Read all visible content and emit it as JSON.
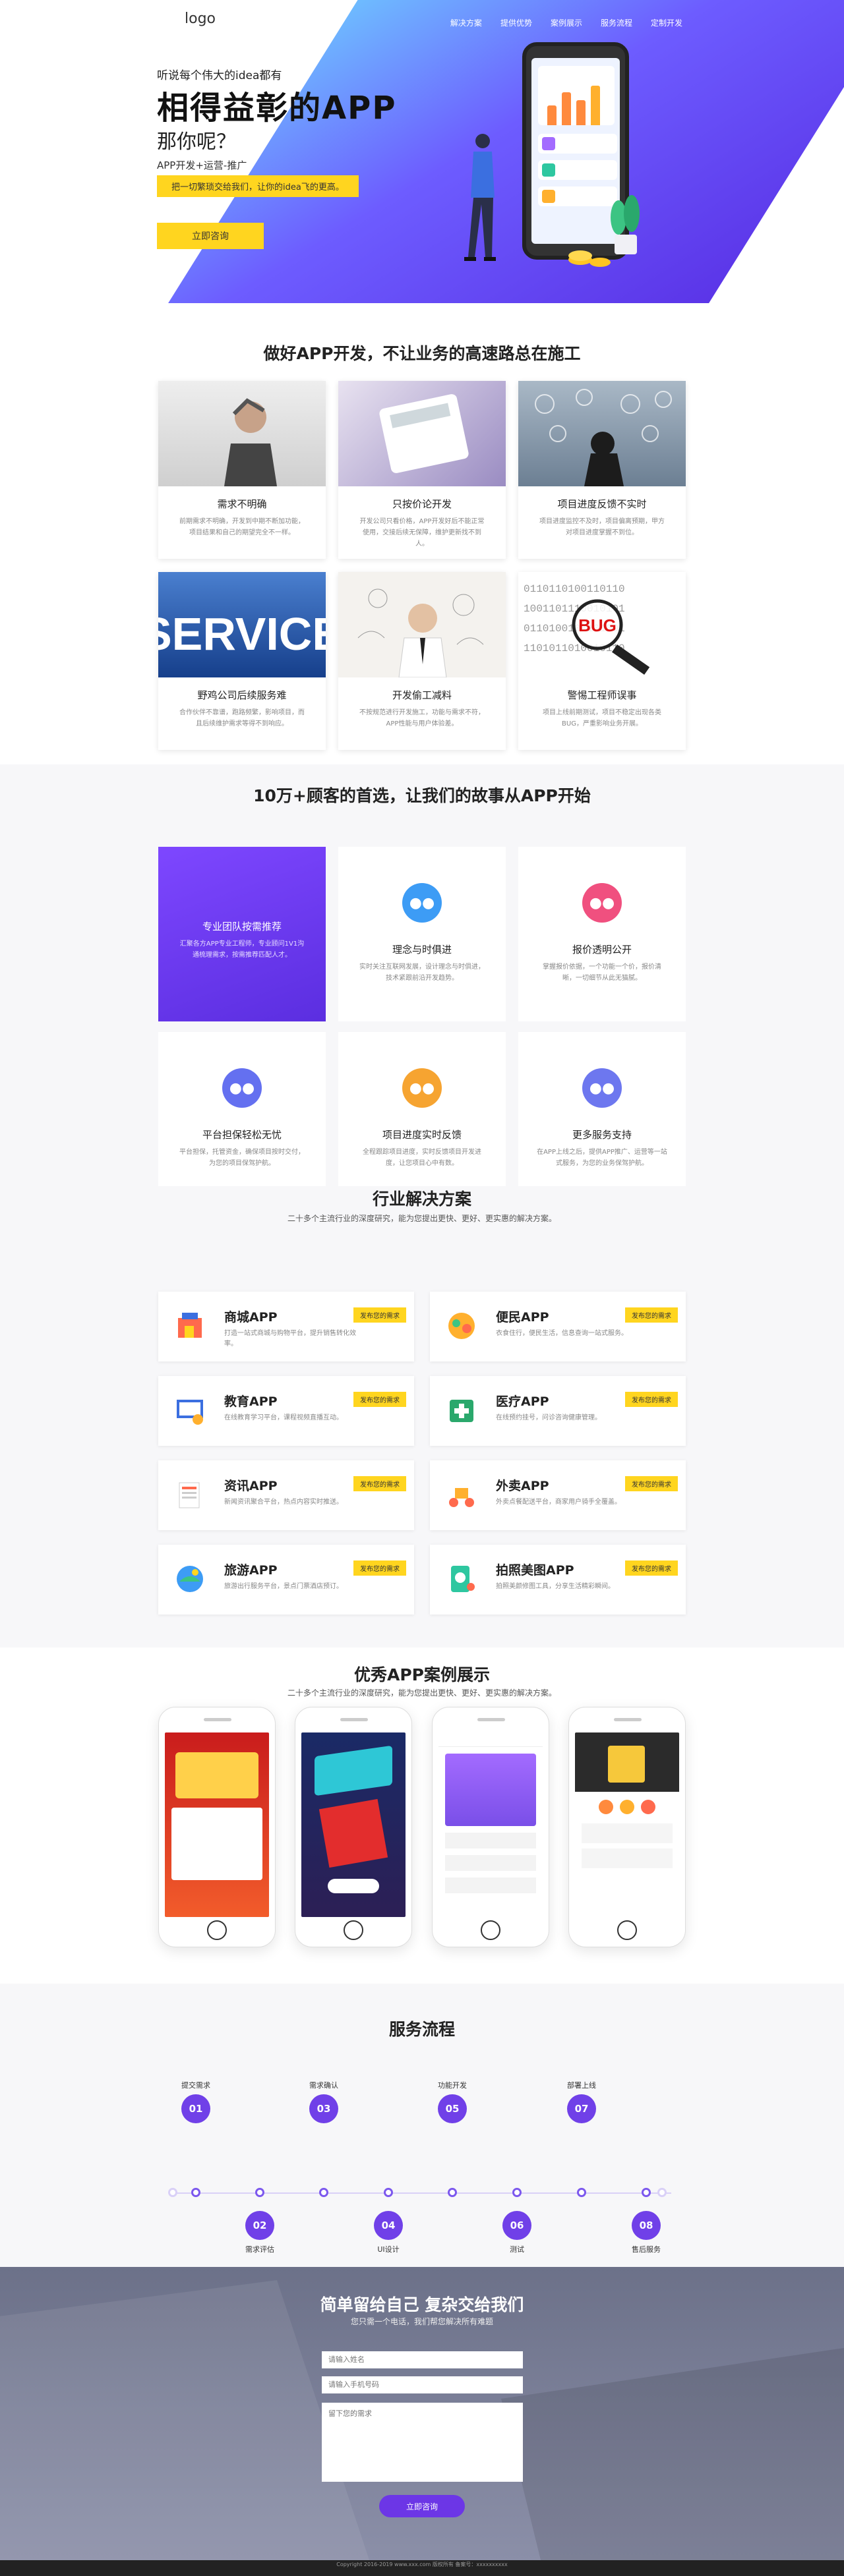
{
  "header": {
    "logo": "logo",
    "nav": [
      "解决方案",
      "提供优势",
      "案例展示",
      "服务流程",
      "定制开发"
    ]
  },
  "hero": {
    "subtitle": "听说每个伟大的idea都有",
    "title": "相得益彰的APP",
    "question": "那你呢？",
    "line": "APP开发+运营-推广",
    "tag": "把一切繁琐交给我们，让你的idea飞的更高。",
    "button": "立即咨询"
  },
  "section2": {
    "title": "做好APP开发，不让业务的高速路总在施工",
    "cards": [
      {
        "title": "需求不明确",
        "desc": "前期需求不明确，开发到中期不断加功能，项目结果和自己的期望完全不一样。"
      },
      {
        "title": "只按价论开发",
        "desc": "开发公司只看价格，APP开发好后不能正常使用，交接后续无保障，维护更新找不到人。"
      },
      {
        "title": "项目进度反馈不实时",
        "desc": "项目进度监控不及时，项目偏离预期，甲方对项目进度掌握不到位。"
      },
      {
        "title": "野鸡公司后续服务难",
        "desc": "合作伙伴不靠谱，跑路频繁，影响项目，而且后续维护需求等得不到响应。"
      },
      {
        "title": "开发偷工减料",
        "desc": "不按规范进行开发施工，功能与需求不符，APP性能与用户体验差。"
      },
      {
        "title": "警惕工程师误事",
        "desc": "项目上线前期测试，项目不稳定出现各类BUG，严重影响业务开展。"
      }
    ]
  },
  "section3": {
    "title": "10万+顾客的首选，让我们的故事从APP开始",
    "featured": {
      "title": "专业团队按需推荐",
      "desc": "汇聚各方APP专业工程师，专业顾问1V1沟通梳理需求，按需推荐匹配人才。"
    },
    "cards": [
      {
        "title": "理念与时俱进",
        "desc": "实时关注互联网发展，设计理念与时俱进，技术紧跟前沿开发趋势。",
        "color": "#3d9cf5"
      },
      {
        "title": "报价透明公开",
        "desc": "掌握报价依据，一个功能一个价，报价清晰，一切细节从此无猫腻。",
        "color": "#f0507f"
      },
      {
        "title": "平台担保轻松无忧",
        "desc": "平台担保，托管资金，确保项目按时交付，为您的项目保驾护航。",
        "color": "#6470f0"
      },
      {
        "title": "项目进度实时反馈",
        "desc": "全程跟踪项目进度，实时反馈项目开发进度，让您项目心中有数。",
        "color": "#f6a431"
      },
      {
        "title": "更多服务支持",
        "desc": "在APP上线之后，提供APP推广、运营等一站式服务，为您的业务保驾护航。",
        "color": "#6d77ef"
      }
    ]
  },
  "section4": {
    "title": "行业解决方案",
    "subtitle": "二十多个主流行业的深度研究，能为您提出更快、更好、更实惠的解决方案。",
    "tag": "发布您的需求",
    "items": [
      {
        "title": "商城APP",
        "desc": "打造一站式商城与购物平台，提升销售转化效率。"
      },
      {
        "title": "便民APP",
        "desc": "衣食住行，便民生活，信息查询一站式服务。"
      },
      {
        "title": "教育APP",
        "desc": "在线教育学习平台，课程视频直播互动。"
      },
      {
        "title": "医疗APP",
        "desc": "在线预约挂号，问诊咨询健康管理。"
      },
      {
        "title": "资讯APP",
        "desc": "新闻资讯聚合平台，热点内容实时推送。"
      },
      {
        "title": "外卖APP",
        "desc": "外卖点餐配送平台，商家用户骑手全覆盖。"
      },
      {
        "title": "旅游APP",
        "desc": "旅游出行服务平台，景点门票酒店预订。"
      },
      {
        "title": "拍照美图APP",
        "desc": "拍照美颜修图工具，分享生活精彩瞬间。"
      }
    ]
  },
  "section5": {
    "title": "优秀APP案例展示",
    "subtitle": "二十多个主流行业的深度研究，能为您提出更快、更好、更实惠的解决方案。"
  },
  "section6": {
    "title": "服务流程",
    "steps": [
      {
        "num": "01",
        "label": "提交需求"
      },
      {
        "num": "02",
        "label": "需求评估"
      },
      {
        "num": "03",
        "label": "需求确认"
      },
      {
        "num": "04",
        "label": "UI设计"
      },
      {
        "num": "05",
        "label": "功能开发"
      },
      {
        "num": "06",
        "label": "测试"
      },
      {
        "num": "07",
        "label": "部署上线"
      },
      {
        "num": "08",
        "label": "售后服务"
      }
    ]
  },
  "section7": {
    "title": "简单留给自己  复杂交给我们",
    "subtitle": "您只需一个电话，我们帮您解决所有难题",
    "name_ph": "请输入姓名",
    "phone_ph": "请输入手机号码",
    "msg_ph": "留下您的需求",
    "submit": "立即咨询"
  },
  "footer": "Copyright 2016-2019 www.xxx.com 版权所有 备案号：xxxxxxxxxx"
}
